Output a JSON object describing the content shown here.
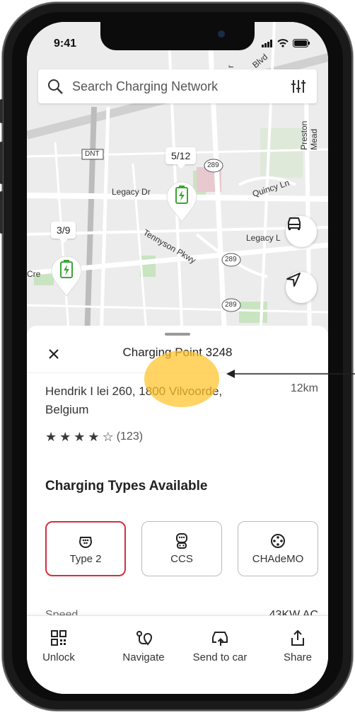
{
  "status_bar": {
    "time": "9:41"
  },
  "search": {
    "placeholder": "Search Charging Network",
    "icon": "search-icon",
    "filter_icon": "sliders-icon"
  },
  "map": {
    "street_labels": [
      "Legacy Dr",
      "Quincy Ln",
      "Legacy L",
      "Tennyson Pkwy",
      "Preston Mead",
      "Blvd",
      "Cre",
      "y",
      "DNT",
      "r"
    ],
    "route_shields": [
      "289",
      "289",
      "289"
    ],
    "stations": [
      {
        "availability": "5/12",
        "icon": "charging-station-icon"
      },
      {
        "availability": "3/9",
        "icon": "charging-station-icon"
      }
    ],
    "buttons": [
      "car-icon",
      "navigation-arrow-icon"
    ]
  },
  "sheet": {
    "title": "Charging Point 3248",
    "address": "Hendrik I lei 260, 1800 Vilvoorde, Belgium",
    "distance": "12km",
    "rating_value": 4,
    "rating_max": 5,
    "rating_count": "(123)",
    "types_heading": "Charging Types Available",
    "charging_types": [
      {
        "label": "Type 2",
        "icon": "type2-connector-icon",
        "selected": true
      },
      {
        "label": "CCS",
        "icon": "ccs-connector-icon",
        "selected": false
      },
      {
        "label": "CHAdeMO",
        "icon": "chademo-connector-icon",
        "selected": false
      }
    ],
    "speed_label": "Speed",
    "speed_value": "43KW AC"
  },
  "tabbar": {
    "items": [
      {
        "label": "Unlock",
        "icon": "qr-code-icon"
      },
      {
        "label": "Navigate",
        "icon": "route-icon"
      },
      {
        "label": "Send to car",
        "icon": "send-to-car-icon"
      },
      {
        "label": "Share",
        "icon": "share-icon"
      }
    ]
  },
  "colors": {
    "accent": "#d1303e",
    "station_green": "#3aa535",
    "highlight": "#ffc428"
  }
}
